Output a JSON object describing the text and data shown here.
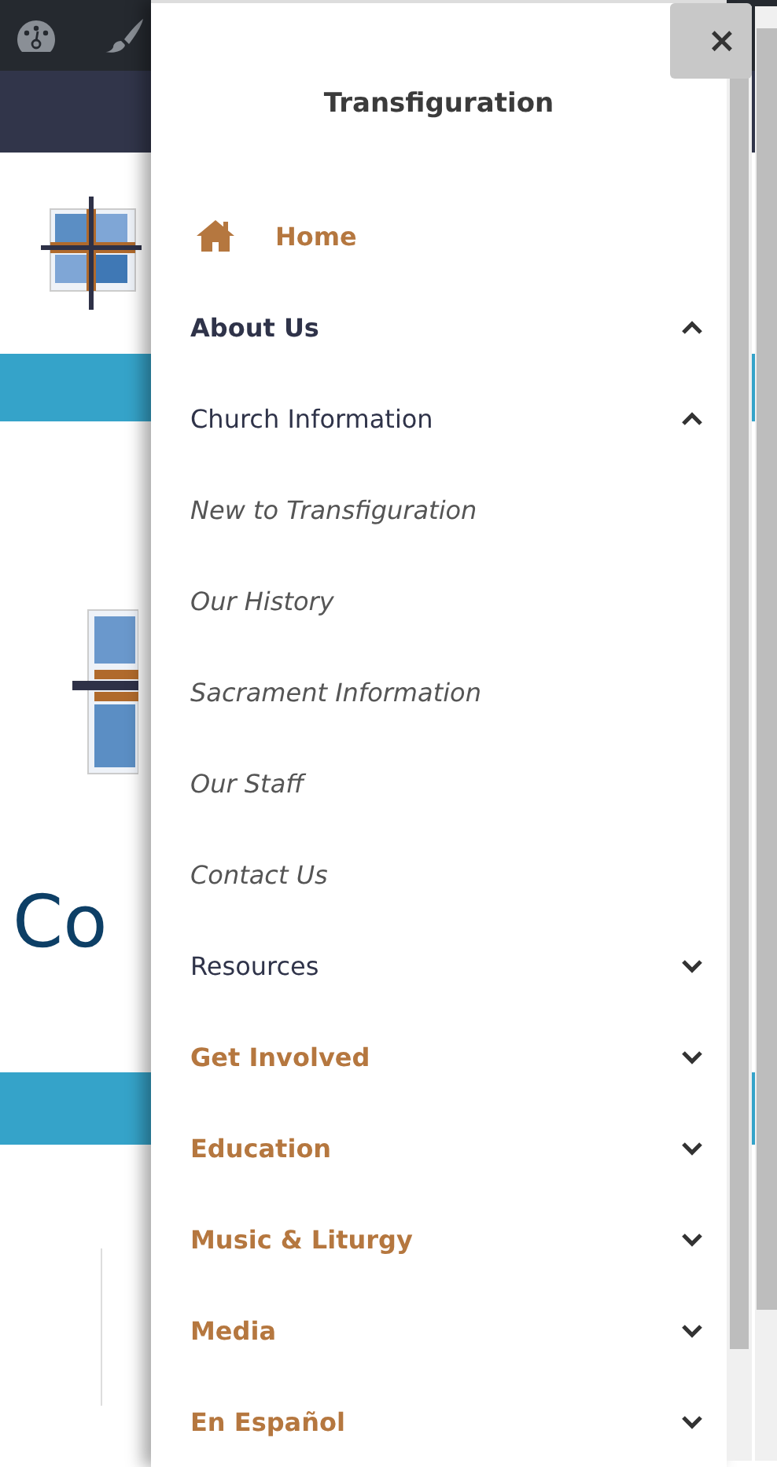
{
  "background_page": {
    "heading": "Co"
  },
  "drawer": {
    "title": "Transfiguration",
    "close": "×",
    "items": [
      {
        "kind": "home",
        "label": "Home"
      },
      {
        "kind": "section",
        "label": "About Us",
        "expanded": true,
        "children": [
          {
            "kind": "section",
            "label": "Church Information",
            "expanded": true,
            "children": [
              {
                "kind": "link",
                "label": "New to Transfiguration"
              },
              {
                "kind": "link",
                "label": "Our History"
              },
              {
                "kind": "link",
                "label": "Sacrament Information"
              },
              {
                "kind": "link",
                "label": "Our Staff"
              },
              {
                "kind": "link",
                "label": "Contact Us"
              }
            ]
          },
          {
            "kind": "section",
            "label": "Resources",
            "expanded": false
          }
        ]
      },
      {
        "kind": "section",
        "label": "Get Involved",
        "expanded": false
      },
      {
        "kind": "section",
        "label": "Education",
        "expanded": false
      },
      {
        "kind": "section",
        "label": "Music & Liturgy",
        "expanded": false
      },
      {
        "kind": "section",
        "label": "Media",
        "expanded": false
      },
      {
        "kind": "section",
        "label": "En Español",
        "expanded": false
      }
    ]
  }
}
